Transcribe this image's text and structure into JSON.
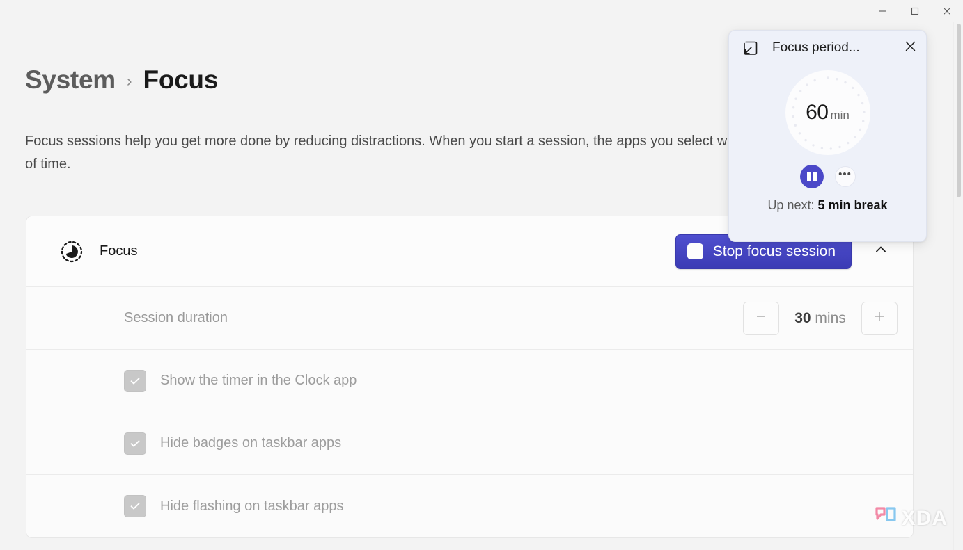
{
  "window": {
    "minimize_label": "Minimize",
    "maximize_label": "Maximize",
    "close_label": "Close"
  },
  "breadcrumb": {
    "parent": "System",
    "separator": "›",
    "current": "Focus"
  },
  "page": {
    "description": "Focus sessions help you get more done by reducing distractions. When you start a session, the apps you select will be blocked for a set amount of time."
  },
  "focus_card": {
    "icon": "focus-timer-icon",
    "title": "Focus",
    "stop_button_label": "Stop focus session",
    "stop_button_color": "#4040bf",
    "collapse_icon": "chevron-up-icon",
    "session_duration": {
      "label": "Session duration",
      "decrement_icon": "minus-icon",
      "increment_icon": "plus-icon",
      "value": "30",
      "unit": "mins"
    },
    "checkboxes": [
      {
        "label": "Show the timer in the Clock app",
        "checked": true,
        "disabled": true
      },
      {
        "label": "Hide badges on taskbar apps",
        "checked": true,
        "disabled": true
      },
      {
        "label": "Hide flashing on taskbar apps",
        "checked": true,
        "disabled": true
      }
    ]
  },
  "popup": {
    "app_icon": "restore-down-icon",
    "title": "Focus period...",
    "close_icon": "close-icon",
    "timer_value": "60",
    "timer_unit": "min",
    "pause_icon": "pause-icon",
    "more_icon": "more-options-icon",
    "more_label": "•••",
    "up_next_prefix": "Up next:",
    "up_next_value": "5 min break",
    "background_color": "#eef1f9",
    "accent_color": "#4b48c8"
  },
  "watermark": {
    "text": "XDA"
  }
}
